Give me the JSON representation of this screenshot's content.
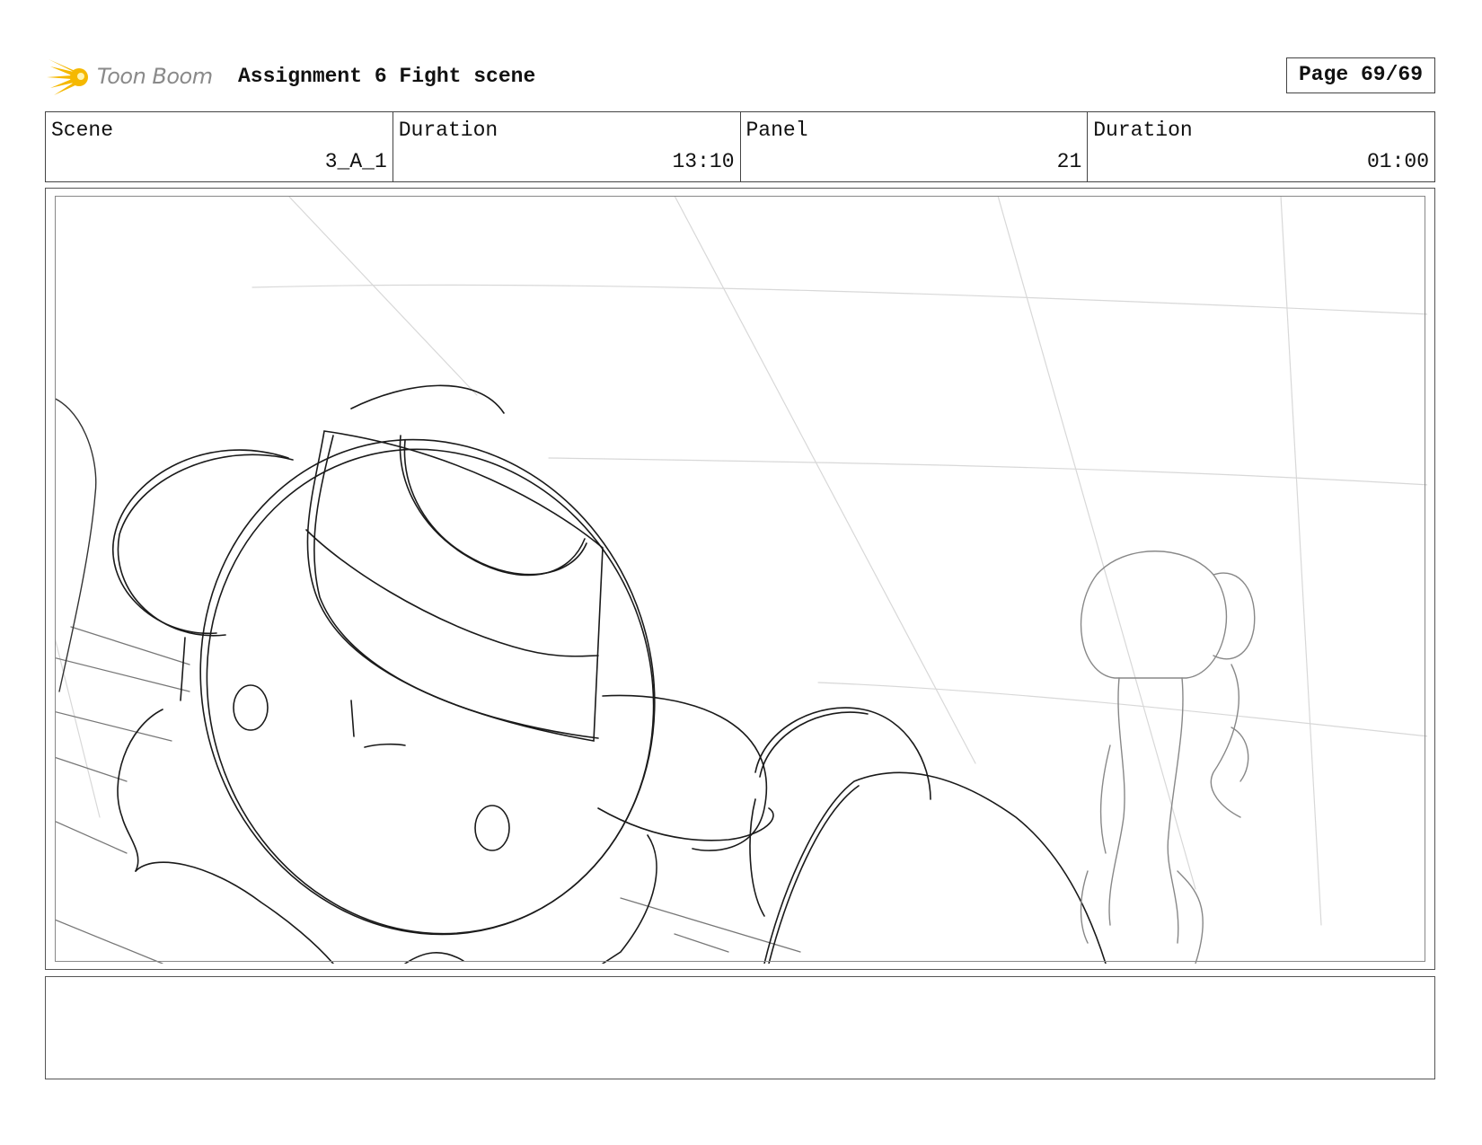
{
  "header": {
    "logo_text": "Toon Boom",
    "doc_title": "Assignment 6 Fight scene",
    "page_label": "Page 69/69"
  },
  "info": {
    "scene_label": "Scene",
    "scene_value": "3_A_1",
    "duration_label": "Duration",
    "duration_value": "13:10",
    "panel_label": "Panel",
    "panel_value": "21",
    "panel_duration_label": "Duration",
    "panel_duration_value": "01:00"
  },
  "notes": {
    "text": ""
  },
  "colors": {
    "logo_accent": "#f5b800",
    "border": "#444444",
    "sketch_line": "#1a1a1a"
  }
}
